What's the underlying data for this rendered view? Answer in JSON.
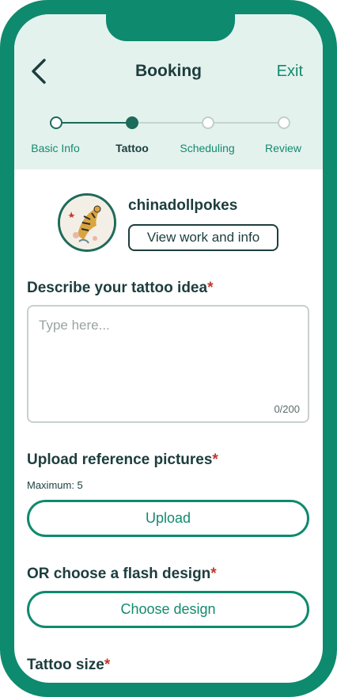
{
  "header": {
    "title": "Booking",
    "exit_label": "Exit"
  },
  "stepper": {
    "steps": [
      {
        "label": "Basic Info",
        "state": "done"
      },
      {
        "label": "Tattoo",
        "state": "active"
      },
      {
        "label": "Scheduling",
        "state": "pending"
      },
      {
        "label": "Review",
        "state": "pending"
      }
    ]
  },
  "artist": {
    "name": "chinadollpokes",
    "view_button": "View work and info"
  },
  "idea": {
    "label": "Describe your tattoo idea",
    "required_mark": "*",
    "placeholder": "Type here...",
    "counter": "0/200"
  },
  "upload": {
    "label": "Upload reference pictures",
    "required_mark": "*",
    "note": "Maximum: 5",
    "button": "Upload"
  },
  "flash": {
    "label": "OR choose a flash design",
    "required_mark": "*",
    "button": "Choose design"
  },
  "size": {
    "label": "Tattoo size",
    "required_mark": "*"
  },
  "colors": {
    "brand_green": "#0e8a6e",
    "dark_text": "#1d3d3d",
    "header_bg": "#e4f2ee",
    "required_red": "#c0392b"
  },
  "icons": {
    "back": "chevron-left-icon",
    "avatar": "tiger-artwork"
  }
}
